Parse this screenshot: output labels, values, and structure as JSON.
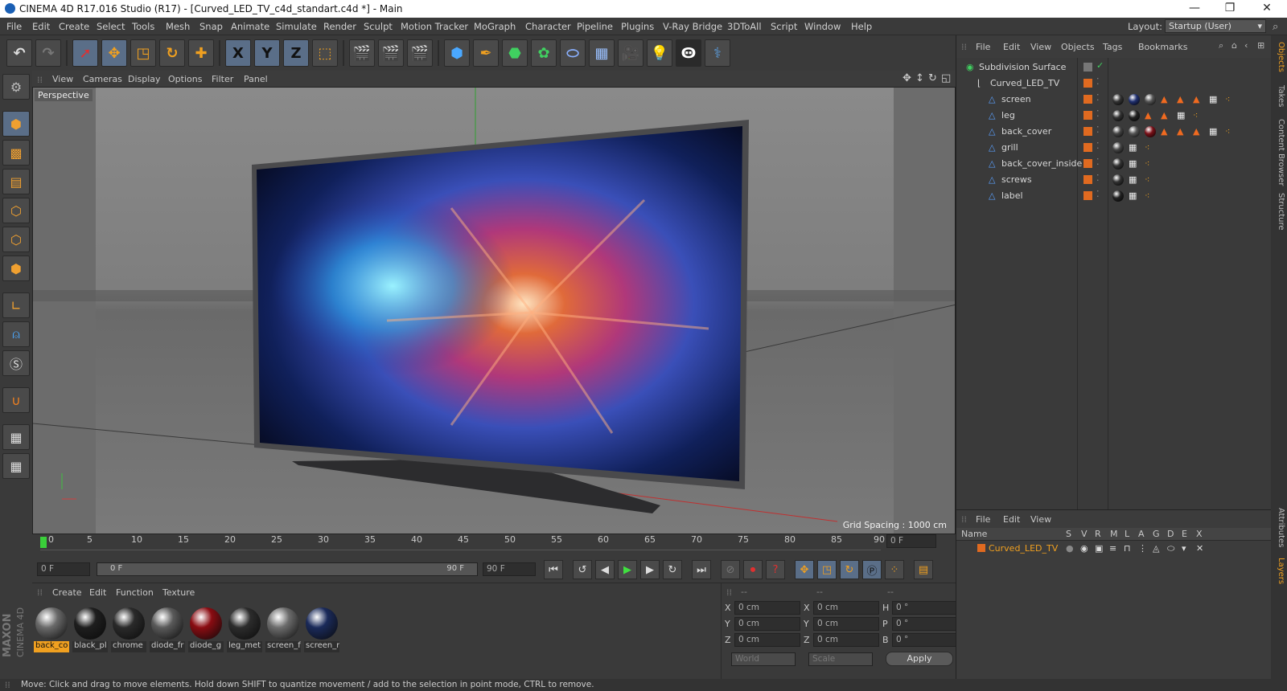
{
  "app": {
    "title": "CINEMA 4D R17.016 Studio (R17) - [Curved_LED_TV_c4d_standart.c4d *] - Main",
    "minimize": "—",
    "maximize": "❐",
    "close": "✕"
  },
  "menubar": {
    "items": [
      "File",
      "Edit",
      "Create",
      "Select",
      "Tools",
      "Mesh",
      "Snap",
      "Animate",
      "Simulate",
      "Render",
      "Sculpt",
      "Motion Tracker",
      "MoGraph",
      "Character",
      "Pipeline",
      "Plugins",
      "V-Ray Bridge",
      "3DToAll",
      "Script",
      "Window",
      "Help"
    ],
    "layout_label": "Layout:",
    "layout_value": "Startup (User)"
  },
  "toolbar": {
    "x_label": "X",
    "y_label": "Y",
    "z_label": "Z"
  },
  "viewport": {
    "menu": [
      "View",
      "Cameras",
      "Display",
      "Options",
      "Filter",
      "Panel"
    ],
    "camera_label": "Perspective",
    "grid_spacing": "Grid Spacing : 1000 cm"
  },
  "timeline": {
    "ticks": [
      "0",
      "5",
      "10",
      "15",
      "20",
      "25",
      "30",
      "35",
      "40",
      "45",
      "50",
      "55",
      "60",
      "65",
      "70",
      "75",
      "80",
      "85",
      "90"
    ],
    "current_frame": "0 F",
    "start_field": "0 F",
    "range_start": "0 F",
    "range_end": "90 F",
    "end_field": "90 F"
  },
  "material_manager": {
    "menu": [
      "Create",
      "Edit",
      "Function",
      "Texture"
    ],
    "materials": [
      {
        "label": "back_co",
        "color": "#6a6a6a",
        "selected": true
      },
      {
        "label": "black_pl",
        "color": "#1e1e1e",
        "selected": false
      },
      {
        "label": "chrome",
        "color": "#2a2a2a",
        "selected": false
      },
      {
        "label": "diode_fr",
        "color": "#5a5a5a",
        "selected": false
      },
      {
        "label": "diode_g",
        "color": "#8a0c12",
        "selected": false
      },
      {
        "label": "leg_met",
        "color": "#2c2c2c",
        "selected": false
      },
      {
        "label": "screen_f",
        "color": "#6c6c6c",
        "selected": false
      },
      {
        "label": "screen_r",
        "color": "#1a2a5a",
        "selected": false
      }
    ],
    "brand_top": "MAXON",
    "brand_bottom": "CINEMA 4D"
  },
  "coordinates": {
    "headers": [
      "--",
      "--",
      "--"
    ],
    "rows": [
      {
        "a": "X",
        "av": "0 cm",
        "b": "X",
        "bv": "0 cm",
        "c": "H",
        "cv": "0 °"
      },
      {
        "a": "Y",
        "av": "0 cm",
        "b": "Y",
        "bv": "0 cm",
        "c": "P",
        "cv": "0 °"
      },
      {
        "a": "Z",
        "av": "0 cm",
        "b": "Z",
        "bv": "0 cm",
        "c": "B",
        "cv": "0 °"
      }
    ],
    "space": "World",
    "mode": "Scale",
    "apply": "Apply"
  },
  "object_manager": {
    "menu": [
      "File",
      "Edit",
      "View",
      "Objects",
      "Tags",
      "Bookmarks"
    ],
    "objects": [
      {
        "name": "Subdivision Surface",
        "level": 0
      },
      {
        "name": "Curved_LED_TV",
        "level": 1
      },
      {
        "name": "screen",
        "level": 2
      },
      {
        "name": "leg",
        "level": 2
      },
      {
        "name": "back_cover",
        "level": 2
      },
      {
        "name": "grill",
        "level": 2
      },
      {
        "name": "back_cover_inside",
        "level": 2
      },
      {
        "name": "screws",
        "level": 2
      },
      {
        "name": "label",
        "level": 2
      }
    ]
  },
  "layer_manager": {
    "menu": [
      "File",
      "Edit",
      "View"
    ],
    "columns": [
      "Name",
      "S",
      "V",
      "R",
      "M",
      "L",
      "A",
      "G",
      "D",
      "E",
      "X"
    ],
    "layer_name": "Curved_LED_TV"
  },
  "right_tabs": [
    "Objects",
    "Takes",
    "Content Browser",
    "Structure",
    "Attributes",
    "Layers"
  ],
  "status": "Move: Click and drag to move elements. Hold down SHIFT to quantize movement / add to the selection in point mode, CTRL to remove."
}
